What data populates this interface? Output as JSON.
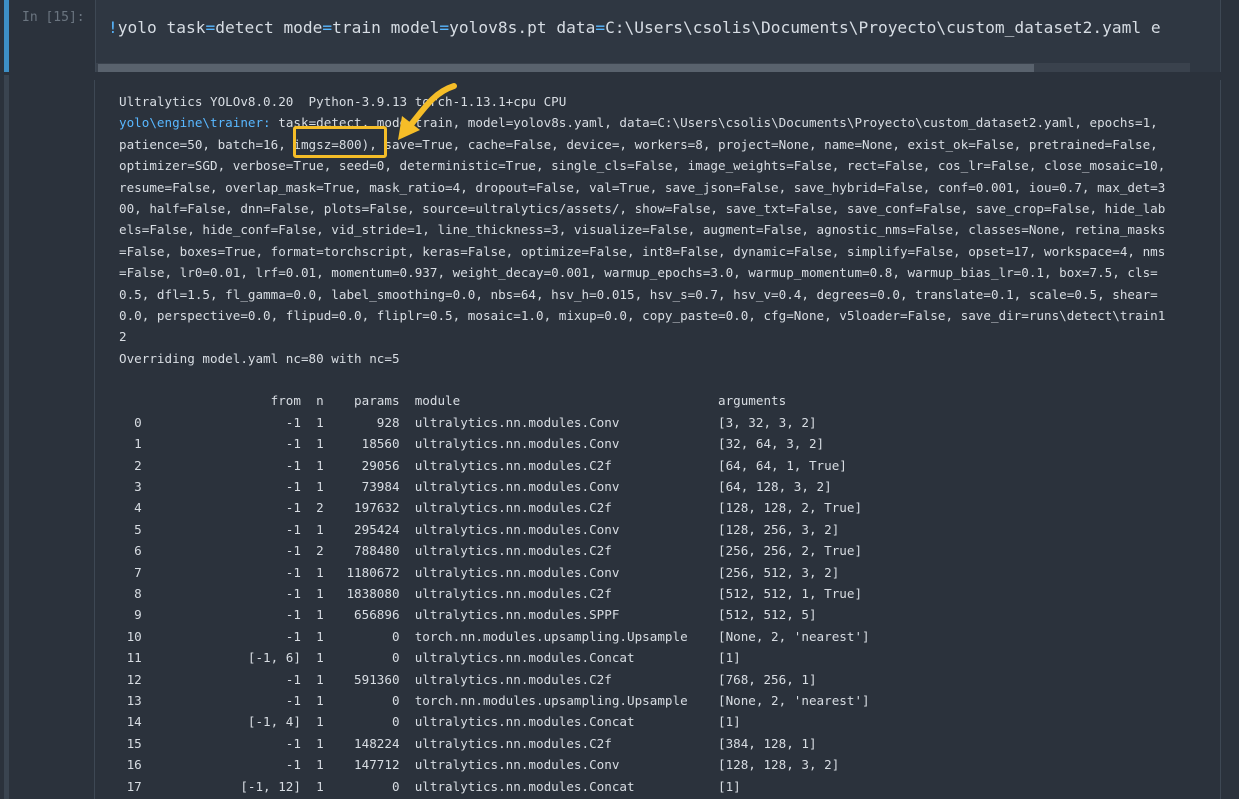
{
  "cell": {
    "prompt": "In [15]:",
    "command_parts": [
      {
        "t": "!",
        "c": "bang"
      },
      {
        "t": "yolo task",
        "c": ""
      },
      {
        "t": "=",
        "c": "eq"
      },
      {
        "t": "detect mode",
        "c": ""
      },
      {
        "t": "=",
        "c": "eq"
      },
      {
        "t": "train model",
        "c": ""
      },
      {
        "t": "=",
        "c": "eq"
      },
      {
        "t": "yolov8s.pt data",
        "c": ""
      },
      {
        "t": "=",
        "c": "eq"
      },
      {
        "t": "C:\\Users\\csolis\\Documents\\Proyecto\\custom_dataset2.yaml e",
        "c": ""
      }
    ]
  },
  "output": {
    "header_lines": [
      "Ultralytics YOLOv8.0.20  Python-3.9.13 torch-1.13.1+cpu CPU",
      {
        "key": "yolo\\engine\\trainer:",
        "text": " task=detect, mode=train, model=yolov8s.yaml, data=C:\\Users\\csolis\\Documents\\Proyecto\\custom_dataset2.yaml, epochs=1,"
      },
      "patience=50, batch=16, imgsz=800), save=True, cache=False, device=, workers=8, project=None, name=None, exist_ok=False, pretrained=False,",
      "optimizer=SGD, verbose=True, seed=0, deterministic=True, single_cls=False, image_weights=False, rect=False, cos_lr=False, close_mosaic=10,",
      "resume=False, overlap_mask=True, mask_ratio=4, dropout=False, val=True, save_json=False, save_hybrid=False, conf=0.001, iou=0.7, max_det=3",
      "00, half=False, dnn=False, plots=False, source=ultralytics/assets/, show=False, save_txt=False, save_conf=False, save_crop=False, hide_lab",
      "els=False, hide_conf=False, vid_stride=1, line_thickness=3, visualize=False, augment=False, agnostic_nms=False, classes=None, retina_masks",
      "=False, boxes=True, format=torchscript, keras=False, optimize=False, int8=False, dynamic=False, simplify=False, opset=17, workspace=4, nms",
      "=False, lr0=0.01, lrf=0.01, momentum=0.937, weight_decay=0.001, warmup_epochs=3.0, warmup_momentum=0.8, warmup_bias_lr=0.1, box=7.5, cls=",
      "0.5, dfl=1.5, fl_gamma=0.0, label_smoothing=0.0, nbs=64, hsv_h=0.015, hsv_s=0.7, hsv_v=0.4, degrees=0.0, translate=0.1, scale=0.5, shear=",
      "0.0, perspective=0.0, flipud=0.0, fliplr=0.5, mosaic=1.0, mixup=0.0, copy_paste=0.0, cfg=None, v5loader=False, save_dir=runs\\detect\\train1",
      "2",
      "Overriding model.yaml nc=80 with nc=5",
      ""
    ],
    "table_header": {
      "idx": "",
      "from": "from",
      "n": "n",
      "params": "params",
      "module": "module",
      "arguments": "arguments"
    },
    "table_rows": [
      {
        "idx": "0",
        "from": "-1",
        "n": "1",
        "params": "928",
        "module": "ultralytics.nn.modules.Conv",
        "arguments": "[3, 32, 3, 2]"
      },
      {
        "idx": "1",
        "from": "-1",
        "n": "1",
        "params": "18560",
        "module": "ultralytics.nn.modules.Conv",
        "arguments": "[32, 64, 3, 2]"
      },
      {
        "idx": "2",
        "from": "-1",
        "n": "1",
        "params": "29056",
        "module": "ultralytics.nn.modules.C2f",
        "arguments": "[64, 64, 1, True]"
      },
      {
        "idx": "3",
        "from": "-1",
        "n": "1",
        "params": "73984",
        "module": "ultralytics.nn.modules.Conv",
        "arguments": "[64, 128, 3, 2]"
      },
      {
        "idx": "4",
        "from": "-1",
        "n": "2",
        "params": "197632",
        "module": "ultralytics.nn.modules.C2f",
        "arguments": "[128, 128, 2, True]"
      },
      {
        "idx": "5",
        "from": "-1",
        "n": "1",
        "params": "295424",
        "module": "ultralytics.nn.modules.Conv",
        "arguments": "[128, 256, 3, 2]"
      },
      {
        "idx": "6",
        "from": "-1",
        "n": "2",
        "params": "788480",
        "module": "ultralytics.nn.modules.C2f",
        "arguments": "[256, 256, 2, True]"
      },
      {
        "idx": "7",
        "from": "-1",
        "n": "1",
        "params": "1180672",
        "module": "ultralytics.nn.modules.Conv",
        "arguments": "[256, 512, 3, 2]"
      },
      {
        "idx": "8",
        "from": "-1",
        "n": "1",
        "params": "1838080",
        "module": "ultralytics.nn.modules.C2f",
        "arguments": "[512, 512, 1, True]"
      },
      {
        "idx": "9",
        "from": "-1",
        "n": "1",
        "params": "656896",
        "module": "ultralytics.nn.modules.SPPF",
        "arguments": "[512, 512, 5]"
      },
      {
        "idx": "10",
        "from": "-1",
        "n": "1",
        "params": "0",
        "module": "torch.nn.modules.upsampling.Upsample",
        "arguments": "[None, 2, 'nearest']"
      },
      {
        "idx": "11",
        "from": "[-1, 6]",
        "n": "1",
        "params": "0",
        "module": "ultralytics.nn.modules.Concat",
        "arguments": "[1]"
      },
      {
        "idx": "12",
        "from": "-1",
        "n": "1",
        "params": "591360",
        "module": "ultralytics.nn.modules.C2f",
        "arguments": "[768, 256, 1]"
      },
      {
        "idx": "13",
        "from": "-1",
        "n": "1",
        "params": "0",
        "module": "torch.nn.modules.upsampling.Upsample",
        "arguments": "[None, 2, 'nearest']"
      },
      {
        "idx": "14",
        "from": "[-1, 4]",
        "n": "1",
        "params": "0",
        "module": "ultralytics.nn.modules.Concat",
        "arguments": "[1]"
      },
      {
        "idx": "15",
        "from": "-1",
        "n": "1",
        "params": "148224",
        "module": "ultralytics.nn.modules.C2f",
        "arguments": "[384, 128, 1]"
      },
      {
        "idx": "16",
        "from": "-1",
        "n": "1",
        "params": "147712",
        "module": "ultralytics.nn.modules.Conv",
        "arguments": "[128, 128, 3, 2]"
      },
      {
        "idx": "17",
        "from": "[-1, 12]",
        "n": "1",
        "params": "0",
        "module": "ultralytics.nn.modules.Concat",
        "arguments": "[1]"
      }
    ]
  },
  "colors": {
    "background": "#2b323c",
    "keyword": "#58b7ff",
    "highlight": "#f5bd28",
    "cell_marker": "#3d8fc6"
  }
}
